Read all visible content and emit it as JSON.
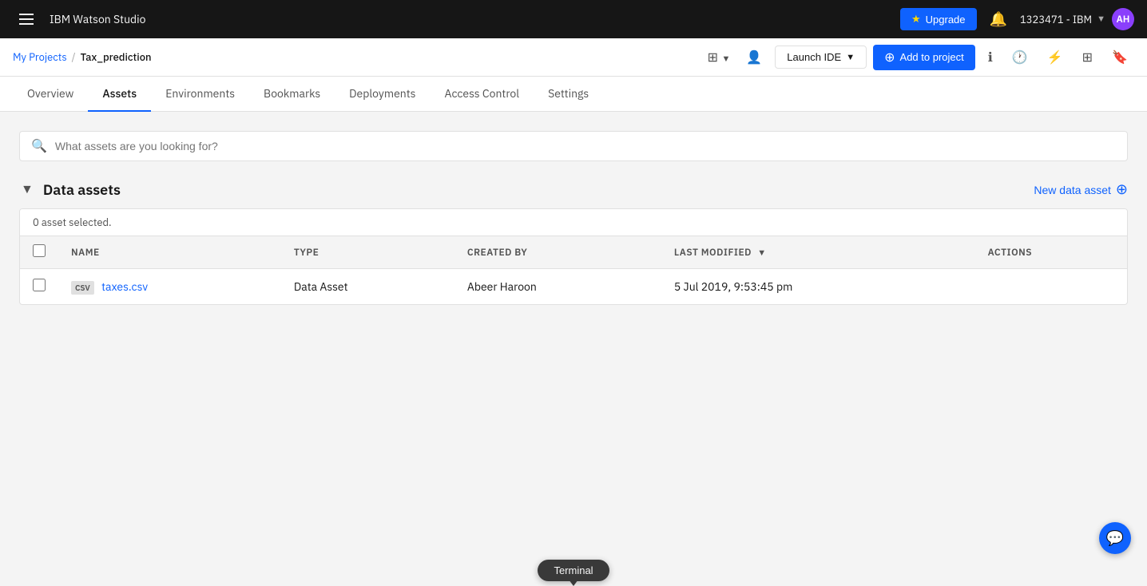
{
  "topbar": {
    "brand": "IBM Watson Studio",
    "upgrade_label": "Upgrade",
    "account_id": "1323471 - IBM",
    "avatar_initials": "AH",
    "menu_icon": "menu-icon"
  },
  "project_bar": {
    "breadcrumb": {
      "projects_label": "My Projects",
      "separator": "/",
      "current": "Tax_prediction"
    },
    "launch_ide_label": "Launch IDE",
    "add_to_project_label": "Add to project"
  },
  "tabs": [
    {
      "id": "overview",
      "label": "Overview"
    },
    {
      "id": "assets",
      "label": "Assets",
      "active": true
    },
    {
      "id": "environments",
      "label": "Environments"
    },
    {
      "id": "bookmarks",
      "label": "Bookmarks"
    },
    {
      "id": "deployments",
      "label": "Deployments"
    },
    {
      "id": "access-control",
      "label": "Access Control"
    },
    {
      "id": "settings",
      "label": "Settings"
    }
  ],
  "search": {
    "placeholder": "What assets are you looking for?"
  },
  "data_assets": {
    "title": "Data assets",
    "new_asset_label": "New data asset",
    "selected_info": "0 asset selected.",
    "columns": [
      {
        "id": "name",
        "label": "NAME"
      },
      {
        "id": "type",
        "label": "TYPE"
      },
      {
        "id": "created_by",
        "label": "CREATED BY"
      },
      {
        "id": "last_modified",
        "label": "LAST MODIFIED",
        "sortable": true,
        "sorted": true
      }
    ],
    "rows": [
      {
        "id": "taxes-csv",
        "badge": "csv",
        "name": "taxes.csv",
        "type": "Data Asset",
        "created_by": "Abeer Haroon",
        "last_modified": "5 Jul 2019, 9:53:45 pm"
      }
    ]
  },
  "terminal": {
    "label": "Terminal"
  },
  "icons": {
    "search": "🔍",
    "collapse": "▼",
    "sort_desc": "▼",
    "bell": "🔔",
    "plus_circle": "⊕",
    "chat": "💬"
  }
}
